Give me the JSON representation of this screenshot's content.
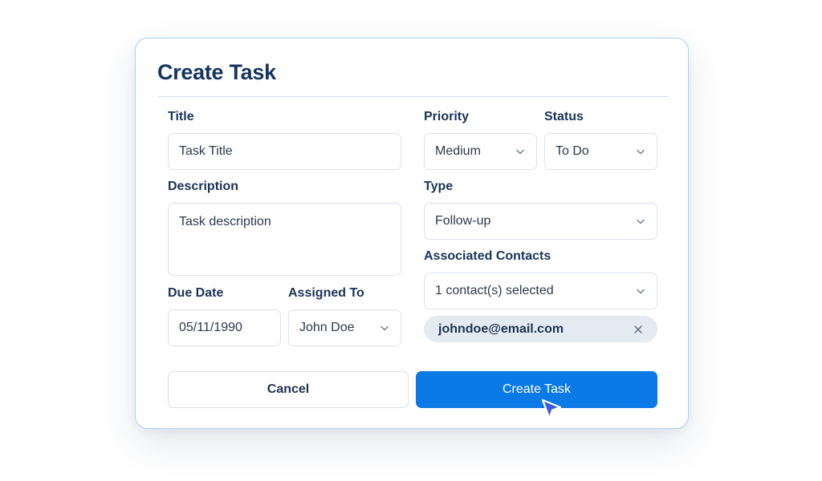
{
  "dialog": {
    "title": "Create Task",
    "fields": {
      "title": {
        "label": "Title",
        "value": "Task Title"
      },
      "description": {
        "label": "Description",
        "value": "Task description"
      },
      "due_date": {
        "label": "Due Date",
        "value": "05/11/1990"
      },
      "assigned_to": {
        "label": "Assigned To",
        "value": "John Doe"
      },
      "priority": {
        "label": "Priority",
        "value": "Medium"
      },
      "status": {
        "label": "Status",
        "value": "To Do"
      },
      "type": {
        "label": "Type",
        "value": "Follow-up"
      },
      "contacts": {
        "label": "Associated Contacts",
        "value": "1 contact(s) selected"
      }
    },
    "selected_contacts": [
      "johndoe@email.com"
    ],
    "buttons": {
      "cancel": "Cancel",
      "create": "Create Task"
    }
  },
  "colors": {
    "primary": "#0b79e6",
    "heading": "#15345e",
    "modal_border": "#a9d2f7",
    "chip_bg": "#e4eaf1",
    "cursor": "#3b5bdb"
  },
  "icons": {
    "select_arrow": "chevron-down-icon",
    "chip_remove": "close-icon",
    "pointer": "cursor-arrow-icon"
  }
}
